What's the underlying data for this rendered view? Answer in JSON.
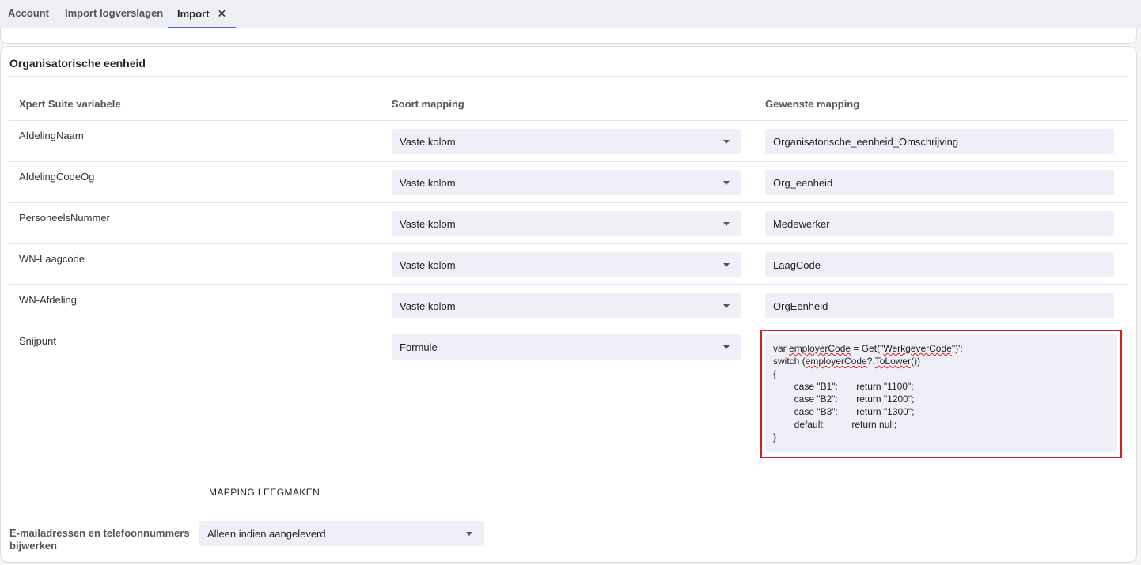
{
  "tabs": [
    {
      "label": "Account"
    },
    {
      "label": "Import logverslagen"
    },
    {
      "label": "Import",
      "close": "✕"
    }
  ],
  "section": {
    "title": "Organisatorische eenheid"
  },
  "columns": {
    "variable": "Xpert Suite variabele",
    "type": "Soort mapping",
    "mapping": "Gewenste mapping"
  },
  "rows": [
    {
      "variable": "AfdelingNaam",
      "type": "Vaste kolom",
      "mapping": "Organisatorische_eenheid_Omschrijving"
    },
    {
      "variable": "AfdelingCodeOg",
      "type": "Vaste kolom",
      "mapping": "Org_eenheid"
    },
    {
      "variable": "PersoneelsNummer",
      "type": "Vaste kolom",
      "mapping": "Medewerker"
    },
    {
      "variable": "WN-Laagcode",
      "type": "Vaste kolom",
      "mapping": "LaagCode"
    },
    {
      "variable": "WN-Afdeling",
      "type": "Vaste kolom",
      "mapping": "OrgEenheid"
    },
    {
      "variable": "Snijpunt",
      "type": "Formule"
    }
  ],
  "formula": {
    "line1_a": "var ",
    "line1_b": "employerCode",
    "line1_c": " = Get(\"",
    "line1_d": "WerkgeverCode",
    "line1_e": "\")';",
    "line2_a": "switch (",
    "line2_b": "employerCode",
    "line2_c": "?.",
    "line2_d": "ToLower",
    "line2_e": "())",
    "line3": "{",
    "line4": "        case \"B1\":       return \"1100\";",
    "line5": "        case \"B2\":       return \"1200\";",
    "line6": "        case \"B3\":       return \"1300\";",
    "line7": "        default:          return null;",
    "line8": "}"
  },
  "clear_button": "MAPPING LEEGMAKEN",
  "email_setting": {
    "label": "E-mailadressen en telefoonnummers bijwerken",
    "value": "Alleen indien aangeleverd"
  },
  "colors": {
    "accent": "#3a64d8",
    "highlight": "#d21f1f",
    "field_bg": "#efeff7"
  }
}
